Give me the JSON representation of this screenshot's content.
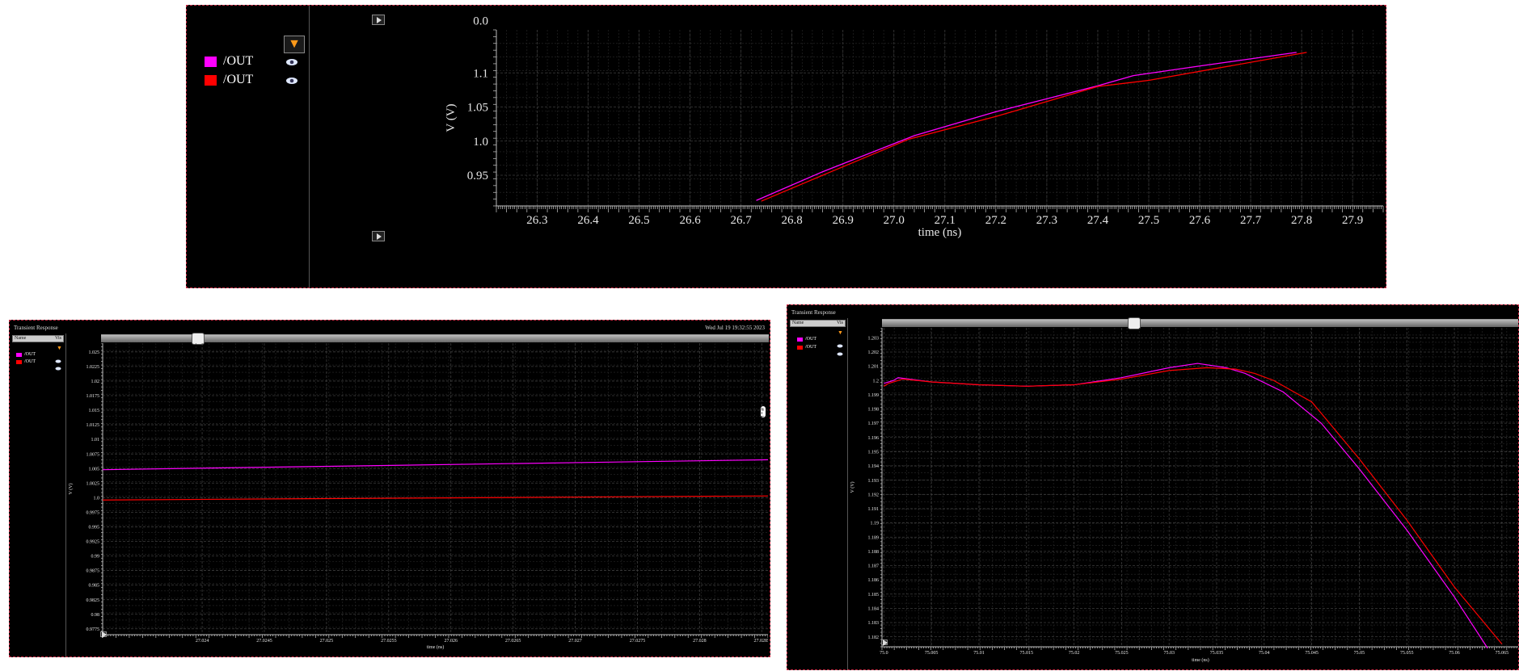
{
  "panels": {
    "top": {
      "legend": [
        {
          "name": "/OUT",
          "color": "#ff00ff",
          "icon": "eye-icon"
        },
        {
          "name": "/OUT",
          "color": "#ff0000",
          "icon": "eye-icon"
        }
      ],
      "filter_icon": "filter-icon"
    },
    "bottom_left": {
      "title": "Transient Response",
      "timestamp": "Wed Jul 19 19:32:55 2023",
      "table_headers": [
        "Name",
        "Vis"
      ],
      "legend": [
        {
          "name": "/OUT",
          "color": "#ff00ff",
          "icon": "eye-icon"
        },
        {
          "name": "/OUT",
          "color": "#ff0000",
          "icon": "eye-icon"
        }
      ]
    },
    "bottom_right": {
      "title": "Transient Response",
      "table_headers": [
        "Name",
        "Vis"
      ],
      "legend": [
        {
          "name": "/OUT",
          "color": "#ff00ff",
          "icon": "eye-icon"
        },
        {
          "name": "/OUT",
          "color": "#ff0000",
          "icon": "eye-icon"
        }
      ]
    }
  },
  "chart_data": [
    {
      "type": "line",
      "xlabel": "time (ns)",
      "ylabel": "V (V)",
      "xlim": [
        26.22,
        27.96
      ],
      "ylim": [
        0.905,
        1.163
      ],
      "x_ticks": [
        "26.3",
        "26.4",
        "26.5",
        "26.6",
        "26.7",
        "26.8",
        "26.9",
        "27.0",
        "27.1",
        "27.2",
        "27.3",
        "27.4",
        "27.5",
        "27.6",
        "27.7",
        "27.8",
        "27.9"
      ],
      "y_ticks": [
        "0.95",
        "1.0",
        "1.05",
        "1.1"
      ],
      "y_top_label": "0.0",
      "grid": true,
      "series": [
        {
          "name": "/OUT",
          "color": "#ff00ff",
          "x": [
            26.73,
            26.86,
            27.04,
            27.2,
            27.4,
            27.47,
            27.6,
            27.79
          ],
          "y": [
            0.913,
            0.955,
            1.008,
            1.043,
            1.081,
            1.096,
            1.11,
            1.13
          ]
        },
        {
          "name": "/OUT",
          "color": "#ff0000",
          "x": [
            26.74,
            26.87,
            27.03,
            27.2,
            27.4,
            27.5,
            27.81
          ],
          "y": [
            0.912,
            0.953,
            1.003,
            1.036,
            1.08,
            1.089,
            1.13
          ]
        }
      ]
    },
    {
      "type": "line",
      "xlabel": "time (ns)",
      "ylabel": "V (V)",
      "xlim": [
        27.0232,
        27.02855
      ],
      "ylim": [
        0.9765,
        1.0265
      ],
      "x_ticks": [
        "27.024",
        "27.0245",
        "27.025",
        "27.0255",
        "27.026",
        "27.0265",
        "27.027",
        "27.0275",
        "27.028",
        "27.0285"
      ],
      "y_ticks": [
        "0.9775",
        "0.98",
        "0.9825",
        "0.985",
        "0.9875",
        "0.99",
        "0.9925",
        "0.995",
        "0.9975",
        "1.0",
        "1.0025",
        "1.005",
        "1.0075",
        "1.01",
        "1.0125",
        "1.015",
        "1.0175",
        "1.02",
        "1.0225",
        "1.025"
      ],
      "grid": true,
      "series": [
        {
          "name": "/OUT",
          "color": "#ff00ff",
          "x": [
            27.0232,
            27.02855
          ],
          "y": [
            1.0048,
            1.0065
          ]
        },
        {
          "name": "/OUT",
          "color": "#ff0000",
          "x": [
            27.0232,
            27.02855
          ],
          "y": [
            0.9996,
            1.0003
          ]
        }
      ]
    },
    {
      "type": "line",
      "xlabel": "time (ns)",
      "ylabel": "V (V)",
      "xlim": [
        74.9998,
        75.0668
      ],
      "ylim": [
        1.1813,
        1.2037
      ],
      "x_ticks": [
        "75.0",
        "75.005",
        "75.01",
        "75.015",
        "75.02",
        "75.025",
        "75.03",
        "75.035",
        "75.04",
        "75.045",
        "75.05",
        "75.055",
        "75.06",
        "75.065"
      ],
      "y_ticks": [
        "1.182",
        "1.183",
        "1.184",
        "1.185",
        "1.186",
        "1.187",
        "1.188",
        "1.189",
        "1.19",
        "1.191",
        "1.192",
        "1.193",
        "1.194",
        "1.195",
        "1.196",
        "1.197",
        "1.198",
        "1.199",
        "1.2",
        "1.201",
        "1.202",
        "1.203"
      ],
      "grid": true,
      "series": [
        {
          "name": "/OUT",
          "color": "#ff00ff",
          "x": [
            75.0,
            75.001,
            75.0015,
            75.005,
            75.01,
            75.015,
            75.02,
            75.025,
            75.03,
            75.033,
            75.036,
            75.038,
            75.042,
            75.046,
            75.05,
            75.055,
            75.06,
            75.0635
          ],
          "y": [
            1.1998,
            1.2,
            1.2002,
            1.1999,
            1.1997,
            1.1996,
            1.1997,
            1.2002,
            1.2009,
            1.2012,
            1.2009,
            1.2005,
            1.1992,
            1.197,
            1.1938,
            1.1895,
            1.1848,
            1.1812
          ]
        },
        {
          "name": "/OUT",
          "color": "#ff0000",
          "x": [
            75.0,
            75.0005,
            75.002,
            75.005,
            75.01,
            75.015,
            75.02,
            75.025,
            75.03,
            75.034,
            75.037,
            75.039,
            75.041,
            75.045,
            75.05,
            75.055,
            75.06,
            75.065
          ],
          "y": [
            1.1996,
            1.1998,
            1.2001,
            1.1999,
            1.1997,
            1.1996,
            1.1997,
            1.2001,
            1.2007,
            1.2009,
            1.2008,
            1.2005,
            1.2,
            1.1985,
            1.1945,
            1.1902,
            1.1855,
            1.1815
          ]
        }
      ]
    }
  ]
}
